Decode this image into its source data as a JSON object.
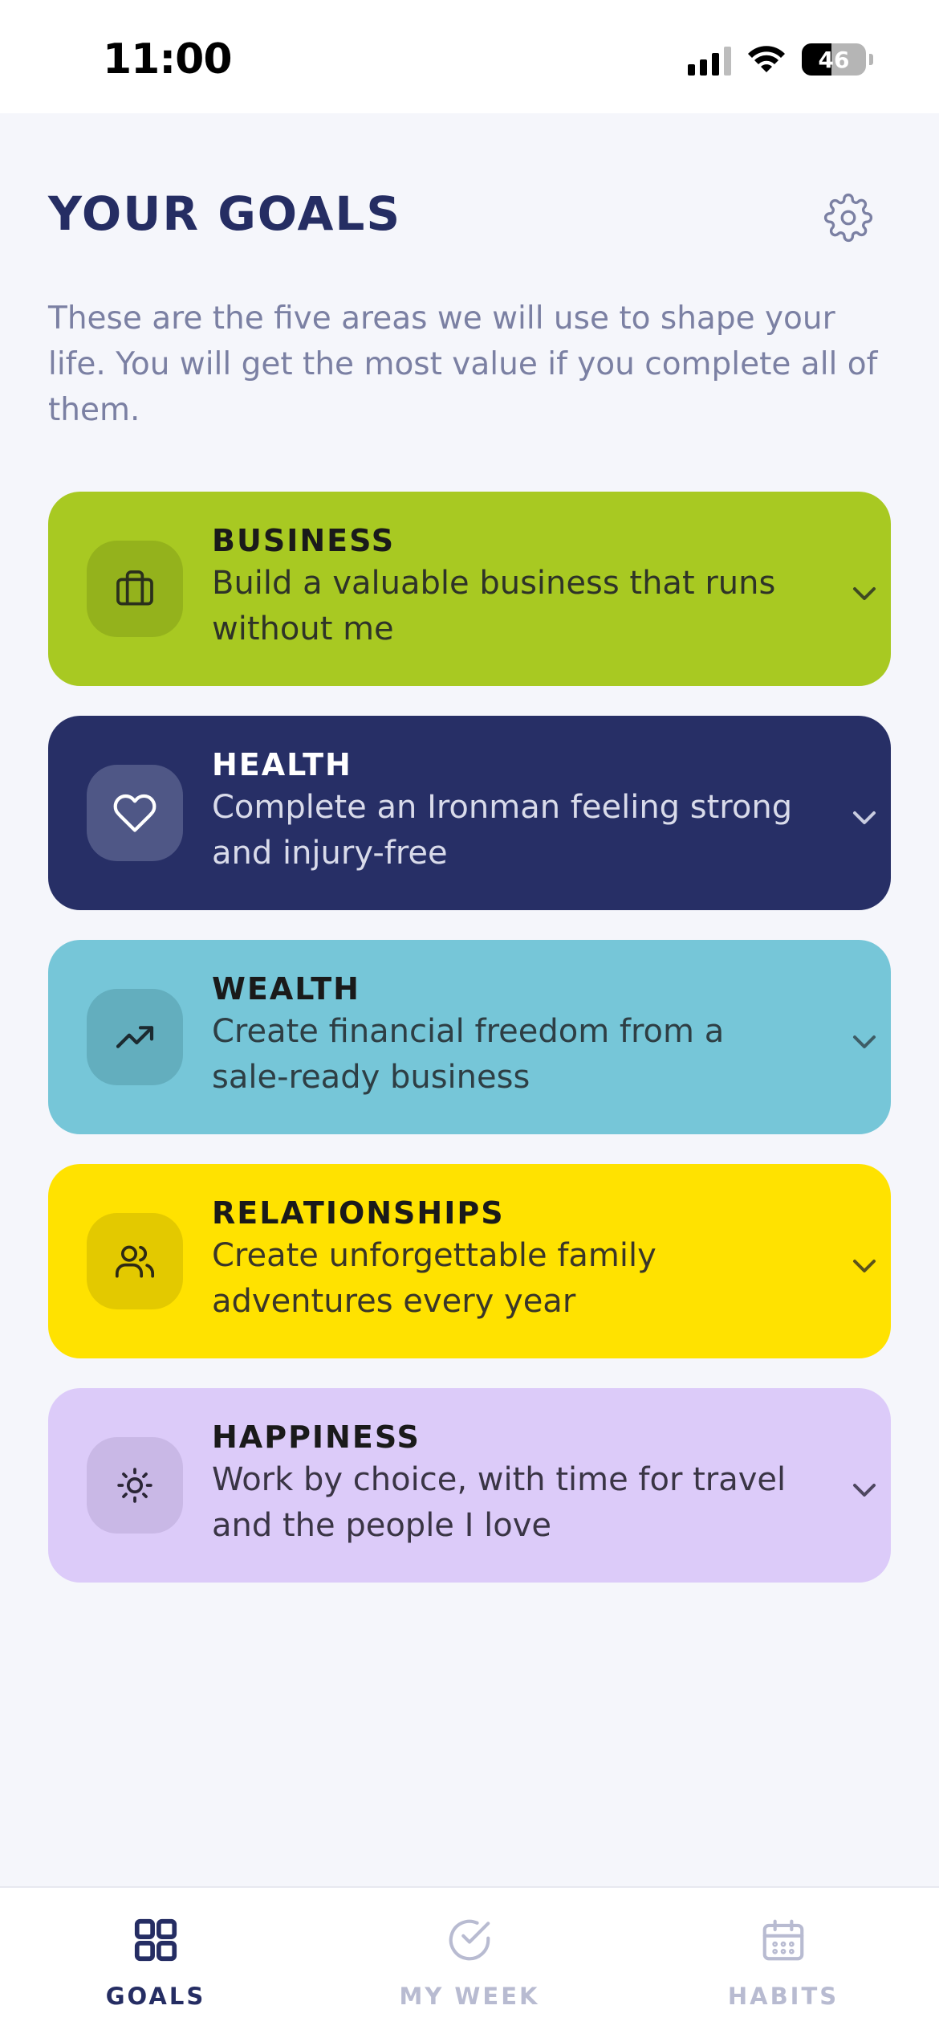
{
  "status_bar": {
    "time": "11:00",
    "battery": "46",
    "battery_level": 0.46
  },
  "header": {
    "title": "YOUR GOALS",
    "settings_icon": "gear-icon"
  },
  "subtitle": "These are the five areas we will use to shape your life. You will get the most value if you complete all of them.",
  "goals": [
    {
      "title": "BUSINESS",
      "description": "Build a valuable business that runs without me",
      "icon": "briefcase-icon",
      "bg": "#a8c922",
      "icon_bg": "#94b21c",
      "title_color": "#1a1a1a",
      "text_color": "#2e3328"
    },
    {
      "title": "HEALTH",
      "description": "Complete an Ironman feeling strong and injury-free",
      "icon": "heart-icon",
      "bg": "#272f66",
      "icon_bg": "#4f5786",
      "title_color": "#ffffff",
      "text_color": "#d9dbea"
    },
    {
      "title": "WEALTH",
      "description": "Create financial freedom from a sale-ready business",
      "icon": "trending-up-icon",
      "bg": "#76c6d8",
      "icon_bg": "#63aebe",
      "title_color": "#1a1a1a",
      "text_color": "#2e3e44"
    },
    {
      "title": "RELATIONSHIPS",
      "description": "Create unforgettable family adventures every year",
      "icon": "users-icon",
      "bg": "#ffe200",
      "icon_bg": "#e3c900",
      "title_color": "#1a1a1a",
      "text_color": "#3a3628"
    },
    {
      "title": "HAPPINESS",
      "description": "Work by choice, with time for travel and the people I love",
      "icon": "sun-icon",
      "bg": "#dccbf9",
      "icon_bg": "#c9b8e6",
      "title_color": "#1a1a1a",
      "text_color": "#3a3545"
    }
  ],
  "tabs": [
    {
      "label": "GOALS",
      "icon": "grid-icon",
      "active": true
    },
    {
      "label": "MY WEEK",
      "icon": "check-circle-icon",
      "active": false
    },
    {
      "label": "HABITS",
      "icon": "calendar-icon",
      "active": false
    }
  ],
  "colors": {
    "primary": "#252d63",
    "inactive_tab": "#b8bbd1",
    "background": "#f5f6fb"
  }
}
